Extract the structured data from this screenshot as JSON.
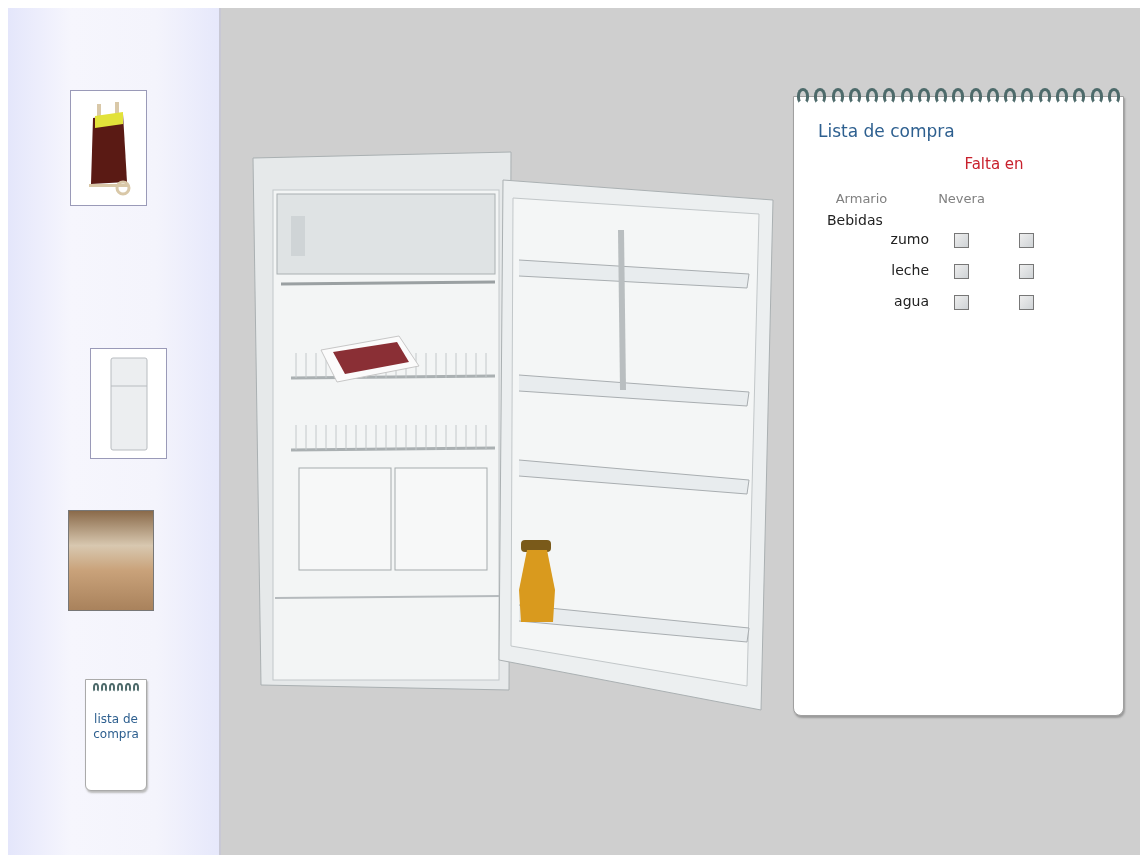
{
  "sidebar": {
    "items": [
      {
        "kind": "cart"
      },
      {
        "kind": "fridge"
      },
      {
        "kind": "kitchen"
      },
      {
        "kind": "note",
        "label": "lista de compra"
      }
    ]
  },
  "shopping_list": {
    "title": "Lista de compra",
    "header": "Falta en",
    "columns": [
      "Armario",
      "Nevera"
    ],
    "categories": [
      {
        "name": "Bebidas",
        "items": [
          {
            "name": "zumo",
            "armario": {
              "checked": false
            },
            "nevera": {
              "checked": false
            }
          },
          {
            "name": "leche",
            "armario": {
              "checked": false
            },
            "nevera": {
              "checked": false
            }
          },
          {
            "name": "agua",
            "armario": {
              "checked": false
            },
            "nevera": {
              "checked": false
            }
          }
        ]
      }
    ]
  }
}
